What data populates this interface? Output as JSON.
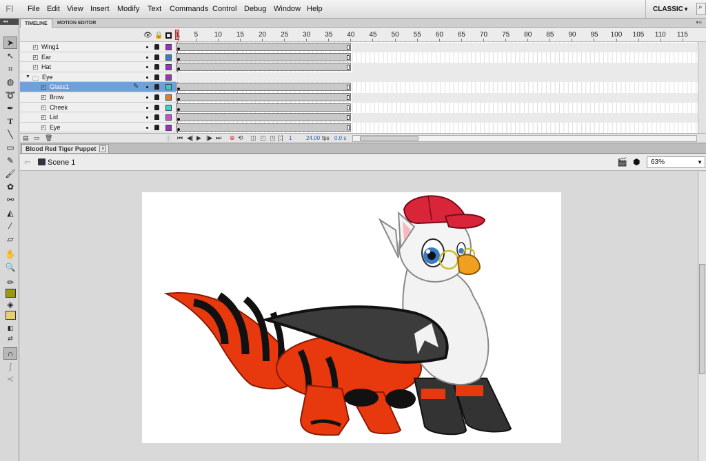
{
  "menu": {
    "logo": "Fl",
    "items": [
      "File",
      "Edit",
      "View",
      "Insert",
      "Modify",
      "Text",
      "Commands",
      "Control",
      "Debug",
      "Window",
      "Help"
    ],
    "workspace": "CLASSIC"
  },
  "timeline": {
    "tabs": [
      "TIMELINE",
      "MOTION EDITOR"
    ],
    "ruler_numbers": [
      "1",
      "5",
      "10",
      "15",
      "20",
      "25",
      "30",
      "35",
      "40",
      "45",
      "50",
      "55",
      "60",
      "65",
      "70",
      "75",
      "80",
      "85",
      "90",
      "95",
      "100",
      "105",
      "110",
      "115"
    ],
    "layers": [
      {
        "name": "Wing1",
        "color": "#9b30c8",
        "folder": false
      },
      {
        "name": "Ear",
        "color": "#3a7ad8",
        "folder": false
      },
      {
        "name": "Hat",
        "color": "#9b30c8",
        "folder": false
      },
      {
        "name": "Eye",
        "color": "#9b30c8",
        "folder": true
      },
      {
        "name": "Glass1",
        "color": "#39c8c8",
        "folder": false,
        "selected": true
      },
      {
        "name": "Brow",
        "color": "#e87a18",
        "folder": false
      },
      {
        "name": "Cheek",
        "color": "#38d0d0",
        "folder": false
      },
      {
        "name": "Lid",
        "color": "#e040e0",
        "folder": false
      },
      {
        "name": "Eye",
        "color": "#9b30c8",
        "folder": false
      }
    ],
    "current_frame": "1",
    "fps": "24.00",
    "fps_unit": "fps",
    "elapsed": "0.0 s"
  },
  "document": {
    "tab_title": "Blood Red Tiger Puppet",
    "scene": "Scene 1",
    "zoom": "63%"
  },
  "colors": {
    "stroke_color": "#9a9a10",
    "fill_color": "#e8d070"
  }
}
